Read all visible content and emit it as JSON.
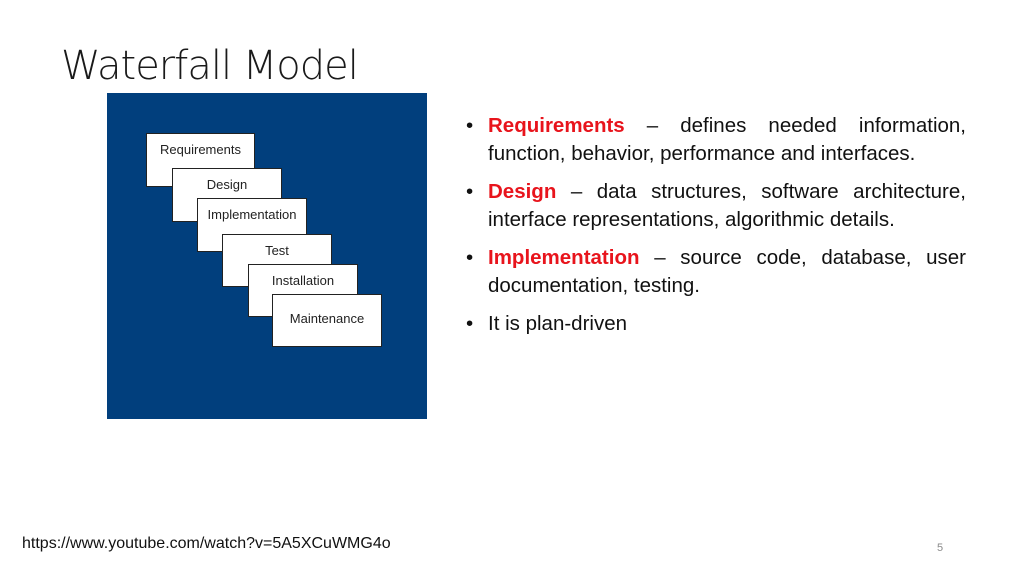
{
  "slide": {
    "title": "Waterfall Model",
    "page_number": "5",
    "source_link": "https://www.youtube.com/watch?v=5A5XCuWMG4o"
  },
  "diagram": {
    "background_color": "#013f7d",
    "stages": [
      {
        "label": "Requirements"
      },
      {
        "label": "Design"
      },
      {
        "label": "Implementation"
      },
      {
        "label": "Test"
      },
      {
        "label": "Installation"
      },
      {
        "label": "Maintenance"
      }
    ]
  },
  "bullets": [
    {
      "term": "Requirements",
      "separator": " – ",
      "text": "defines needed information, function, behavior, performance and interfaces."
    },
    {
      "term": "Design",
      "separator": " – ",
      "text": "data structures, software architecture, interface representations, algorithmic details."
    },
    {
      "term": "Implementation",
      "separator": " – ",
      "text": "source code, database, user documentation, testing."
    },
    {
      "term": "",
      "separator": "",
      "text": "It is plan-driven"
    }
  ],
  "bullet_glyph": "•",
  "colors": {
    "accent_term": "#e8141c",
    "panel_blue": "#013f7d"
  }
}
